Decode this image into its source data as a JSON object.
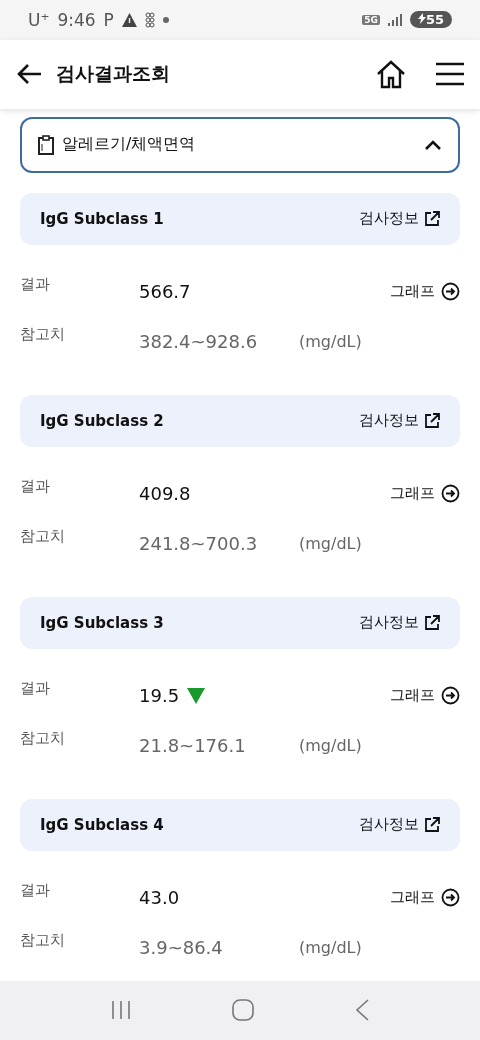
{
  "status_bar": {
    "carrier": "U⁺",
    "time": "9:46",
    "app_letter": "P",
    "network": "5G",
    "battery": "55"
  },
  "header": {
    "title": "검사결과조회"
  },
  "section": {
    "title": "알레르기/체액면역",
    "expanded": true
  },
  "tests": [
    {
      "name": "IgG Subclass 1",
      "info_link": "검사정보",
      "result_label": "결과",
      "result": "566.7",
      "below_range": false,
      "graph_link": "그래프",
      "ref_label": "참고치",
      "ref_range": "382.4~928.6",
      "unit": "(mg/dL)"
    },
    {
      "name": "IgG Subclass 2",
      "info_link": "검사정보",
      "result_label": "결과",
      "result": "409.8",
      "below_range": false,
      "graph_link": "그래프",
      "ref_label": "참고치",
      "ref_range": "241.8~700.3",
      "unit": "(mg/dL)"
    },
    {
      "name": "IgG Subclass 3",
      "info_link": "검사정보",
      "result_label": "결과",
      "result": "19.5",
      "below_range": true,
      "graph_link": "그래프",
      "ref_label": "참고치",
      "ref_range": "21.8~176.1",
      "unit": "(mg/dL)"
    },
    {
      "name": "IgG Subclass 4",
      "info_link": "검사정보",
      "result_label": "결과",
      "result": "43.0",
      "below_range": false,
      "graph_link": "그래프",
      "ref_label": "참고치",
      "ref_range": "3.9~86.4",
      "unit": "(mg/dL)"
    }
  ]
}
